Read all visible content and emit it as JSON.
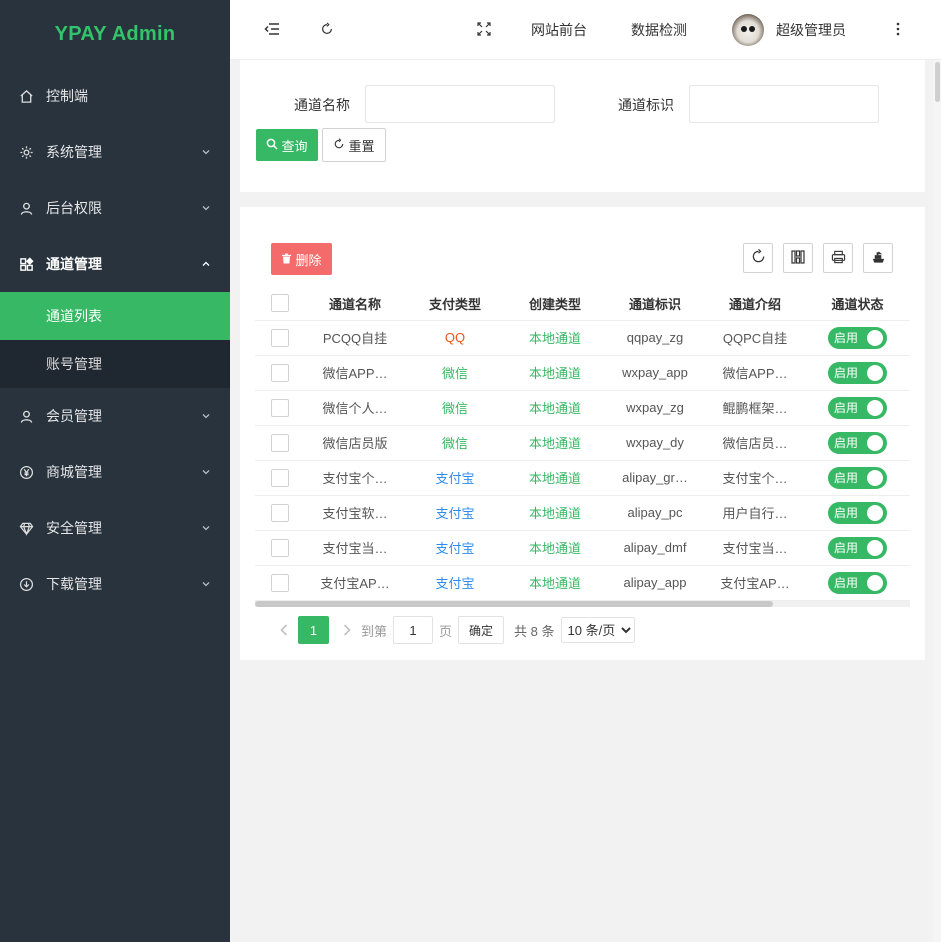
{
  "sidebar": {
    "logo": "YPAY Admin",
    "items": [
      {
        "label": "控制端",
        "icon": "home-icon"
      },
      {
        "label": "系统管理",
        "icon": "gear-icon"
      },
      {
        "label": "后台权限",
        "icon": "user-icon"
      },
      {
        "label": "通道管理",
        "icon": "apps-icon"
      },
      {
        "label": "会员管理",
        "icon": "user-icon"
      },
      {
        "label": "商城管理",
        "icon": "yen-icon"
      },
      {
        "label": "安全管理",
        "icon": "diamond-icon"
      },
      {
        "label": "下载管理",
        "icon": "download-icon"
      }
    ],
    "submenu": [
      {
        "label": "通道列表",
        "active": true
      },
      {
        "label": "账号管理",
        "active": false
      }
    ]
  },
  "header": {
    "link_frontend": "网站前台",
    "link_check": "数据检测",
    "username": "超级管理员"
  },
  "search": {
    "name_label": "通道名称",
    "name_value": "",
    "ident_label": "通道标识",
    "ident_value": "",
    "query_label": "查询",
    "reset_label": "重置"
  },
  "toolbar": {
    "delete_label": "删除"
  },
  "table": {
    "columns": [
      "通道名称",
      "支付类型",
      "创建类型",
      "通道标识",
      "通道介绍",
      "通道状态"
    ],
    "rows": [
      {
        "name": "PCQQ自挂",
        "pay_type": "QQ",
        "pay_color": "#e8541e",
        "create_type": "本地通道",
        "ident": "qqpay_zg",
        "intro": "QQPC自挂",
        "status": "启用"
      },
      {
        "name": "微信APP…",
        "pay_type": "微信",
        "pay_color": "#37b865",
        "create_type": "本地通道",
        "ident": "wxpay_app",
        "intro": "微信APP…",
        "status": "启用"
      },
      {
        "name": "微信个人…",
        "pay_type": "微信",
        "pay_color": "#37b865",
        "create_type": "本地通道",
        "ident": "wxpay_zg",
        "intro": "鲲鹏框架…",
        "status": "启用"
      },
      {
        "name": "微信店员版",
        "pay_type": "微信",
        "pay_color": "#37b865",
        "create_type": "本地通道",
        "ident": "wxpay_dy",
        "intro": "微信店员…",
        "status": "启用"
      },
      {
        "name": "支付宝个…",
        "pay_type": "支付宝",
        "pay_color": "#2d8cf0",
        "create_type": "本地通道",
        "ident": "alipay_gr…",
        "intro": "支付宝个…",
        "status": "启用"
      },
      {
        "name": "支付宝软…",
        "pay_type": "支付宝",
        "pay_color": "#2d8cf0",
        "create_type": "本地通道",
        "ident": "alipay_pc",
        "intro": "用户自行…",
        "status": "启用"
      },
      {
        "name": "支付宝当…",
        "pay_type": "支付宝",
        "pay_color": "#2d8cf0",
        "create_type": "本地通道",
        "ident": "alipay_dmf",
        "intro": "支付宝当…",
        "status": "启用"
      },
      {
        "name": "支付宝AP…",
        "pay_type": "支付宝",
        "pay_color": "#2d8cf0",
        "create_type": "本地通道",
        "ident": "alipay_app",
        "intro": "支付宝AP…",
        "status": "启用"
      }
    ]
  },
  "pager": {
    "current_page": "1",
    "goto_label": "到第",
    "goto_value": "1",
    "page_unit": "页",
    "confirm_label": "确定",
    "total_label": "共 8 条",
    "page_size": "10 条/页"
  },
  "colors": {
    "accent": "#37b865",
    "sidebar_bg": "#28333e",
    "danger": "#f36b6b"
  }
}
